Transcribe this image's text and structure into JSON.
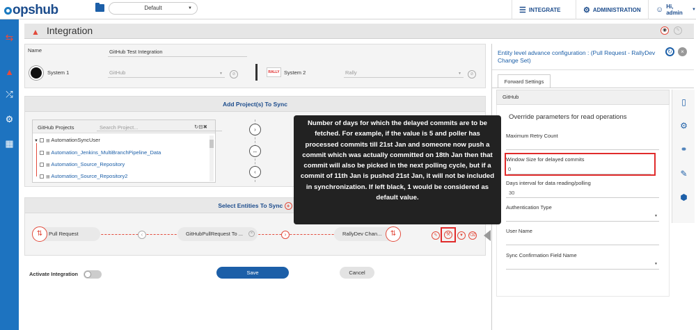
{
  "app": {
    "logo": "opshub"
  },
  "topbar": {
    "workspace": "Default",
    "integrate": "INTEGRATE",
    "administration": "ADMINISTRATION",
    "user": "Hi, admin"
  },
  "page": {
    "title": "Integration"
  },
  "form": {
    "name_label": "Name",
    "name_value": "GitHub Test Integration",
    "system1_label": "System 1",
    "system1_value": "GitHub",
    "system2_label": "System 2",
    "system2_value": "Rally",
    "rally_logo": "RALLY"
  },
  "projects": {
    "section_title": "Add Project(s) To Sync",
    "tree_title": "GitHub Projects",
    "search_placeholder": "Search Project...",
    "root": "AutomationSyncUser",
    "items": [
      "Automation_Jenkins_MultiBranchPipeline_Data",
      "Automation_Source_Repository",
      "Automation_Source_Repository2"
    ]
  },
  "entities": {
    "section_title": "Select Entities To Sync",
    "source": "Pull Request",
    "mapping": "GitHubPullRequest To ...",
    "target": "RallyDev Chan..."
  },
  "footer": {
    "activate_label": "Activate Integration",
    "save": "Save",
    "cancel": "Cancel"
  },
  "tooltip": {
    "text": "Number of days for which the delayed commits are to be fetched. For example, if the value is 5 and poller has processed commits till 21st Jan and someone now push a commit which was actually committed on 18th Jan then that commit will also be picked in the next polling cycle, but if a commit of 11th Jan is pushed 21st Jan, it will not be included in synchronization. If left black, 1 would be considered as default value."
  },
  "advanced": {
    "title": "Entity level advance configuration : (Pull Request - RallyDev Change Set)",
    "tab": "Forward Settings",
    "system": "GitHub",
    "override": "Override parameters for read operations",
    "max_retry_label": "Maximum Retry Count",
    "window_size_label": "Window Size for delayed commits",
    "window_size_value": "0",
    "days_interval_label": "Days interval for data reading/polling",
    "days_interval_value": "30",
    "auth_type_label": "Authentication Type",
    "user_name_label": "User Name",
    "sync_field_label": "Sync Confirmation Field Name"
  },
  "colors": {
    "brand": "#1d73c0",
    "accent": "#e24a3b",
    "highlight": "#e02b2b"
  }
}
